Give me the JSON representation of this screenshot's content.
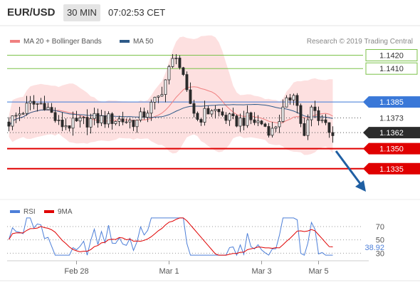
{
  "header": {
    "symbol": "EUR/USD",
    "timeframe": "30 MIN",
    "time": "07:02:53 CET"
  },
  "legend": {
    "bb": "MA 20 + Bollinger Bands",
    "ma50": "MA 50",
    "credit": "Research © 2019 Trading Central"
  },
  "rsi_legend": {
    "rsi": "RSI",
    "ma": "9MA"
  },
  "colors": {
    "bb_band": "#fde0e0",
    "ma20": "#f08080",
    "ma50": "#2e5a88",
    "level_green": "#7cc24a",
    "level_blue": "#3a78d8",
    "level_red": "#e00000",
    "rsi": "#4d7fd8",
    "rsi_ma": "#e00000",
    "candle": "#2a2a2a",
    "arrow": "#1f5fa3"
  },
  "chart_data": [
    {
      "type": "candlestick",
      "ylim": [
        1.1313,
        1.144
      ],
      "levels": [
        {
          "value": 1.142,
          "label": "1.1420",
          "style": "green-line"
        },
        {
          "value": 1.141,
          "label": "1.1410",
          "style": "green-line"
        },
        {
          "value": 1.1385,
          "label": "1.1385",
          "style": "blue-line"
        },
        {
          "value": 1.1373,
          "label": "1.1373",
          "style": "dotted"
        },
        {
          "value": 1.1362,
          "label": "1.1362",
          "style": "current-price"
        },
        {
          "value": 1.135,
          "label": "1.1350",
          "style": "red-line"
        },
        {
          "value": 1.1335,
          "label": "1.1335",
          "style": "red-line"
        }
      ],
      "x_ticks": [
        "Feb 28",
        "Mar 1",
        "Mar 3",
        "Mar 5"
      ],
      "forecast": {
        "from": 1.1362,
        "to": 1.1335
      }
    },
    {
      "type": "line",
      "series": [
        {
          "name": "RSI"
        },
        {
          "name": "9MA"
        }
      ],
      "ylim": [
        25,
        85
      ],
      "y_ticks": [
        70,
        50,
        30
      ],
      "current": "38.92"
    }
  ]
}
